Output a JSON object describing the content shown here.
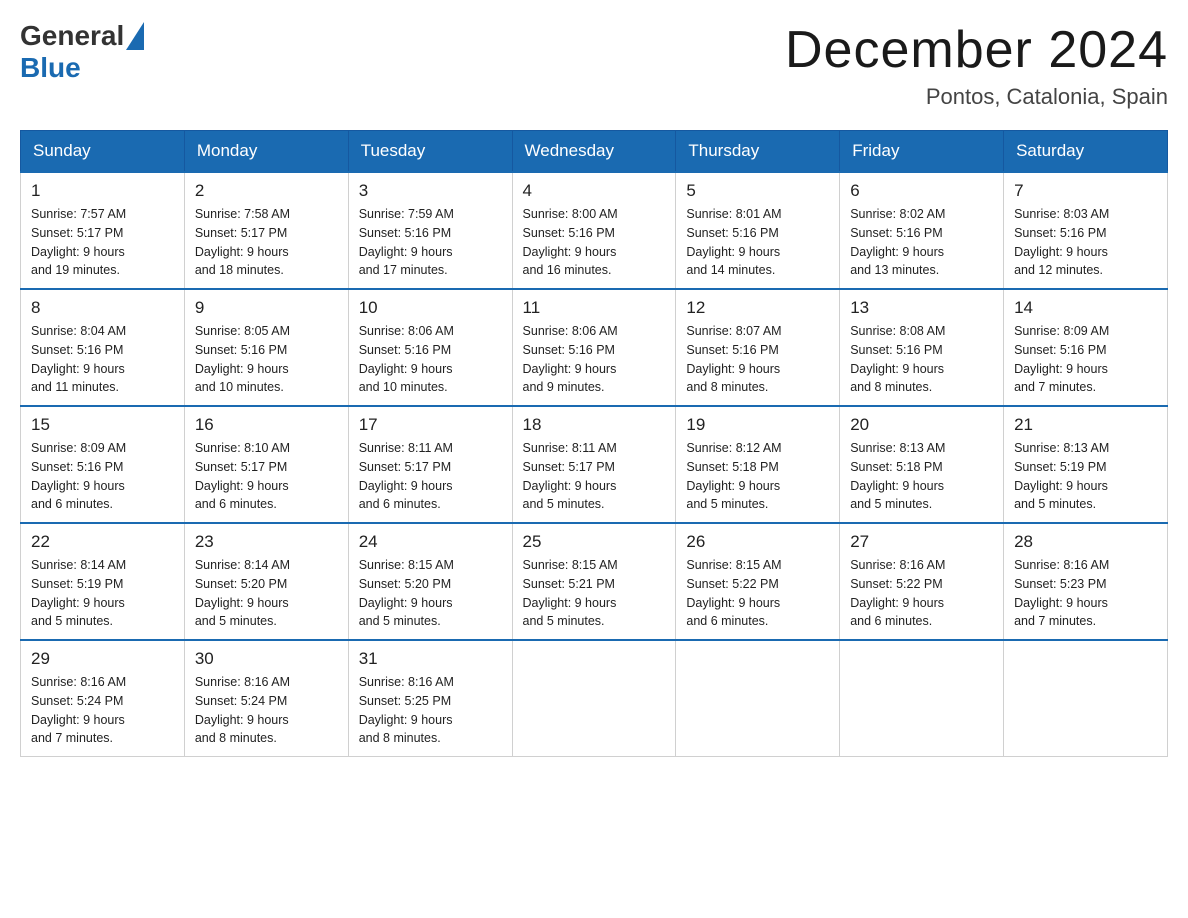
{
  "logo": {
    "general": "General",
    "blue": "Blue"
  },
  "title": "December 2024",
  "subtitle": "Pontos, Catalonia, Spain",
  "days_of_week": [
    "Sunday",
    "Monday",
    "Tuesday",
    "Wednesday",
    "Thursday",
    "Friday",
    "Saturday"
  ],
  "weeks": [
    [
      {
        "day": "1",
        "info": "Sunrise: 7:57 AM\nSunset: 5:17 PM\nDaylight: 9 hours\nand 19 minutes."
      },
      {
        "day": "2",
        "info": "Sunrise: 7:58 AM\nSunset: 5:17 PM\nDaylight: 9 hours\nand 18 minutes."
      },
      {
        "day": "3",
        "info": "Sunrise: 7:59 AM\nSunset: 5:16 PM\nDaylight: 9 hours\nand 17 minutes."
      },
      {
        "day": "4",
        "info": "Sunrise: 8:00 AM\nSunset: 5:16 PM\nDaylight: 9 hours\nand 16 minutes."
      },
      {
        "day": "5",
        "info": "Sunrise: 8:01 AM\nSunset: 5:16 PM\nDaylight: 9 hours\nand 14 minutes."
      },
      {
        "day": "6",
        "info": "Sunrise: 8:02 AM\nSunset: 5:16 PM\nDaylight: 9 hours\nand 13 minutes."
      },
      {
        "day": "7",
        "info": "Sunrise: 8:03 AM\nSunset: 5:16 PM\nDaylight: 9 hours\nand 12 minutes."
      }
    ],
    [
      {
        "day": "8",
        "info": "Sunrise: 8:04 AM\nSunset: 5:16 PM\nDaylight: 9 hours\nand 11 minutes."
      },
      {
        "day": "9",
        "info": "Sunrise: 8:05 AM\nSunset: 5:16 PM\nDaylight: 9 hours\nand 10 minutes."
      },
      {
        "day": "10",
        "info": "Sunrise: 8:06 AM\nSunset: 5:16 PM\nDaylight: 9 hours\nand 10 minutes."
      },
      {
        "day": "11",
        "info": "Sunrise: 8:06 AM\nSunset: 5:16 PM\nDaylight: 9 hours\nand 9 minutes."
      },
      {
        "day": "12",
        "info": "Sunrise: 8:07 AM\nSunset: 5:16 PM\nDaylight: 9 hours\nand 8 minutes."
      },
      {
        "day": "13",
        "info": "Sunrise: 8:08 AM\nSunset: 5:16 PM\nDaylight: 9 hours\nand 8 minutes."
      },
      {
        "day": "14",
        "info": "Sunrise: 8:09 AM\nSunset: 5:16 PM\nDaylight: 9 hours\nand 7 minutes."
      }
    ],
    [
      {
        "day": "15",
        "info": "Sunrise: 8:09 AM\nSunset: 5:16 PM\nDaylight: 9 hours\nand 6 minutes."
      },
      {
        "day": "16",
        "info": "Sunrise: 8:10 AM\nSunset: 5:17 PM\nDaylight: 9 hours\nand 6 minutes."
      },
      {
        "day": "17",
        "info": "Sunrise: 8:11 AM\nSunset: 5:17 PM\nDaylight: 9 hours\nand 6 minutes."
      },
      {
        "day": "18",
        "info": "Sunrise: 8:11 AM\nSunset: 5:17 PM\nDaylight: 9 hours\nand 5 minutes."
      },
      {
        "day": "19",
        "info": "Sunrise: 8:12 AM\nSunset: 5:18 PM\nDaylight: 9 hours\nand 5 minutes."
      },
      {
        "day": "20",
        "info": "Sunrise: 8:13 AM\nSunset: 5:18 PM\nDaylight: 9 hours\nand 5 minutes."
      },
      {
        "day": "21",
        "info": "Sunrise: 8:13 AM\nSunset: 5:19 PM\nDaylight: 9 hours\nand 5 minutes."
      }
    ],
    [
      {
        "day": "22",
        "info": "Sunrise: 8:14 AM\nSunset: 5:19 PM\nDaylight: 9 hours\nand 5 minutes."
      },
      {
        "day": "23",
        "info": "Sunrise: 8:14 AM\nSunset: 5:20 PM\nDaylight: 9 hours\nand 5 minutes."
      },
      {
        "day": "24",
        "info": "Sunrise: 8:15 AM\nSunset: 5:20 PM\nDaylight: 9 hours\nand 5 minutes."
      },
      {
        "day": "25",
        "info": "Sunrise: 8:15 AM\nSunset: 5:21 PM\nDaylight: 9 hours\nand 5 minutes."
      },
      {
        "day": "26",
        "info": "Sunrise: 8:15 AM\nSunset: 5:22 PM\nDaylight: 9 hours\nand 6 minutes."
      },
      {
        "day": "27",
        "info": "Sunrise: 8:16 AM\nSunset: 5:22 PM\nDaylight: 9 hours\nand 6 minutes."
      },
      {
        "day": "28",
        "info": "Sunrise: 8:16 AM\nSunset: 5:23 PM\nDaylight: 9 hours\nand 7 minutes."
      }
    ],
    [
      {
        "day": "29",
        "info": "Sunrise: 8:16 AM\nSunset: 5:24 PM\nDaylight: 9 hours\nand 7 minutes."
      },
      {
        "day": "30",
        "info": "Sunrise: 8:16 AM\nSunset: 5:24 PM\nDaylight: 9 hours\nand 8 minutes."
      },
      {
        "day": "31",
        "info": "Sunrise: 8:16 AM\nSunset: 5:25 PM\nDaylight: 9 hours\nand 8 minutes."
      },
      null,
      null,
      null,
      null
    ]
  ]
}
